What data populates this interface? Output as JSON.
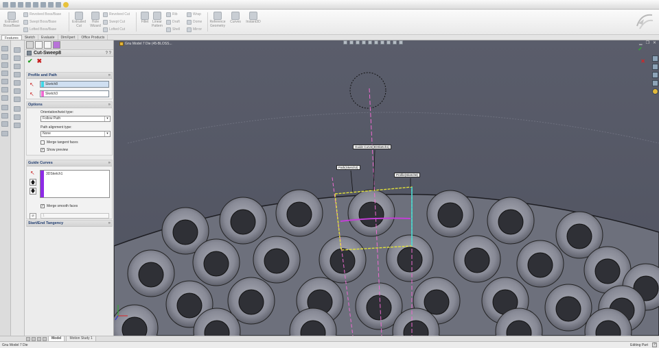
{
  "command_manager": {
    "extruded_boss": "Extruded\nBoss/Base",
    "revolved_boss": "Revolved Boss/Base",
    "swept_boss": "Swept Boss/Base",
    "lofted_boss": "Lofted Boss/Base",
    "extruded_cut": "Extruded\nCut",
    "hole_wizard": "Hole\nWizard",
    "revolved_cut": "Revolved Cut",
    "swept_cut": "Swept Cut",
    "lofted_cut": "Lofted Cut",
    "fillet": "Fillet",
    "linear_pattern": "Linear\nPattern",
    "rib": "Rib",
    "draft": "Draft",
    "shell": "Shell",
    "wrap": "Wrap",
    "dome": "Dome",
    "mirror": "Mirror",
    "reference_geometry": "Reference\nGeometry",
    "curves": "Curves",
    "instant3d": "Instant3D"
  },
  "tabs": [
    "Features",
    "Sketch",
    "Evaluate",
    "DimXpert",
    "Office Products"
  ],
  "active_tab": "Features",
  "property_manager": {
    "title": "Cut-Sweep8",
    "help": "? ?",
    "ok_symbol": "✔",
    "cancel_symbol": "✖",
    "profile_path": {
      "header": "Profile and Path",
      "profile_value": "Sketch8",
      "profile_color": "#3ed7e6",
      "path_value": "Sketch3",
      "path_color": "#f06bd2"
    },
    "options": {
      "header": "Options",
      "orientation_label": "Orientation/twist type:",
      "orientation_value": "Follow Path",
      "alignment_label": "Path alignment type:",
      "alignment_value": "None",
      "merge_tangent_label": "Merge tangent faces",
      "merge_tangent_checked": false,
      "show_preview_label": "Show preview",
      "show_preview_checked": true,
      "checkmark": "✓"
    },
    "guide_curves": {
      "header": "Guide Curves",
      "item": "3DSketch1",
      "item_color": "#8e2ae6",
      "merge_smooth_label": "Merge smooth faces",
      "merge_smooth_checked": true,
      "spin_value": "1"
    },
    "start_end": {
      "header": "Start/End Tangency"
    }
  },
  "viewport": {
    "doc_name": "Gnu Model 7 Die  (45-BLOSS...",
    "labels": {
      "guide_curve": "Guide Curve(3DSketch1)",
      "path": "Path(Sketch3)",
      "profile": "Profile(Sketch8)"
    },
    "colors": {
      "background": "#5b5e6c",
      "part": "#6c6f7b",
      "profile": "#e2e23a",
      "guide": "#c23fd6",
      "path": "#f06bd2",
      "cyan": "#38e0e8"
    }
  },
  "bottom_tabs": [
    "Model",
    "Motion Study 1"
  ],
  "active_bottom_tab": "Model",
  "status": {
    "left": "Gnu Model 7 Die",
    "editing": "Editing Part",
    "help": "?"
  }
}
